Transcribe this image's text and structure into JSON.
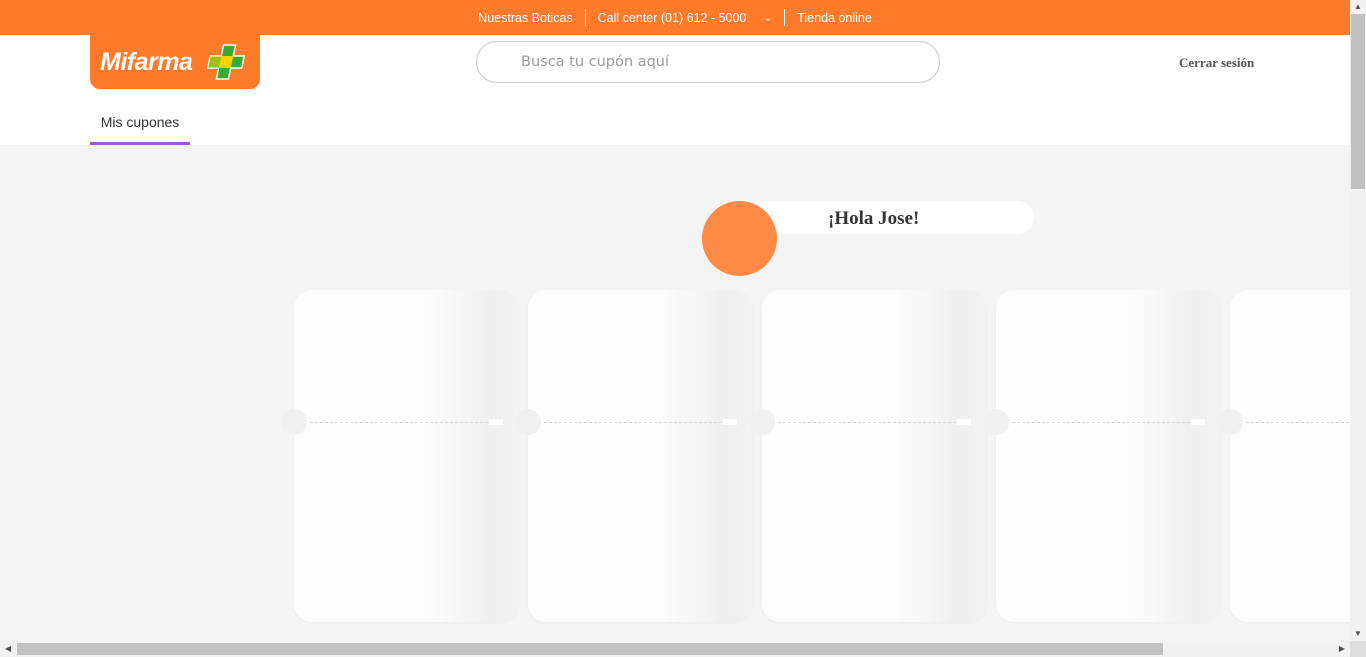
{
  "topbar": {
    "stores_label": "Nuestras Boticas",
    "callcenter_label": "Call center (01) 612 - 5000",
    "callcenter_chevron": "chevron-down-icon",
    "online_store_label": "Tienda online"
  },
  "brand": {
    "logo_text": "Mifarma",
    "primary_color": "#ff7b2a",
    "accent_green": "#3aaa35",
    "accent_yellow": "#f5d200"
  },
  "search": {
    "placeholder": "Busca tu cupón aquí",
    "value": ""
  },
  "header": {
    "logout_label": "Cerrar sesión"
  },
  "tabs": [
    {
      "label": "Mis cupones",
      "active": true,
      "underline_color": "#9b59d0"
    }
  ],
  "greeting": {
    "text": "¡Hola Jose!",
    "avatar_color": "#ff8a45"
  },
  "coupons": {
    "count_visible": 5,
    "items": [
      {
        "state": "loading-placeholder"
      },
      {
        "state": "loading-placeholder"
      },
      {
        "state": "loading-placeholder"
      },
      {
        "state": "loading-placeholder"
      },
      {
        "state": "loading-placeholder"
      }
    ]
  },
  "scrollbars": {
    "vertical_position_fraction": 0.0,
    "horizontal_position_fraction": 0.0
  }
}
